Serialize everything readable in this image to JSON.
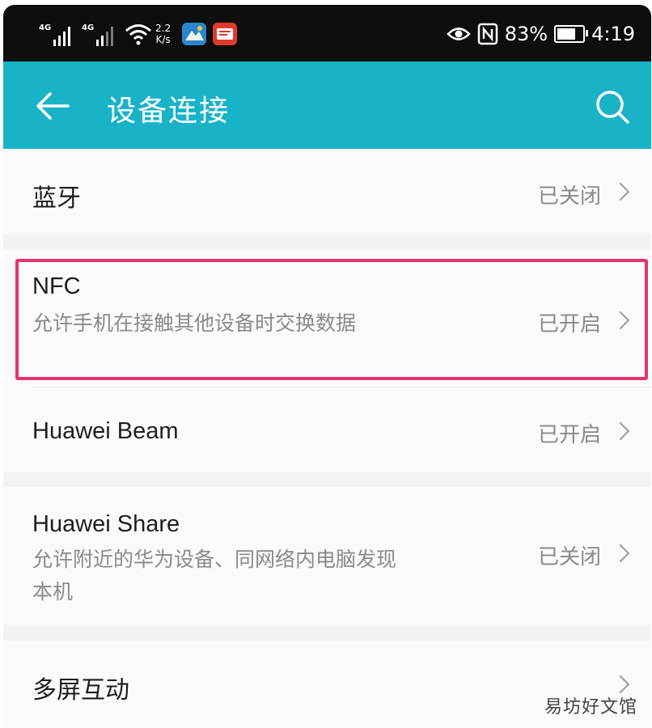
{
  "status_bar": {
    "signal1_label": "4G",
    "signal2_label": "4G",
    "speed_value": "2.2",
    "speed_unit": "K/s",
    "battery_percent": "83%",
    "battery_level": 0.83,
    "time": "4:19",
    "icons": [
      "signal-icon",
      "wifi-icon",
      "app-icon",
      "app-icon",
      "eye-icon",
      "nfc-icon",
      "battery-icon"
    ]
  },
  "app_bar": {
    "title": "设备连接",
    "back_icon": "arrow-left-icon",
    "search_icon": "search-icon",
    "color": "#19b3c8"
  },
  "settings": {
    "bluetooth": {
      "title": "蓝牙",
      "status": "已关闭"
    },
    "nfc": {
      "title": "NFC",
      "description": "允许手机在接触其他设备时交换数据",
      "status": "已开启"
    },
    "huawei_beam": {
      "title": "Huawei Beam",
      "status": "已开启"
    },
    "huawei_share": {
      "title": "Huawei Share",
      "description": "允许附近的华为设备、同网络内电脑发现本机",
      "status": "已关闭"
    },
    "multi_screen": {
      "title": "多屏互动"
    }
  },
  "highlight_color": "#e5336f",
  "watermark": "易坊好文馆"
}
